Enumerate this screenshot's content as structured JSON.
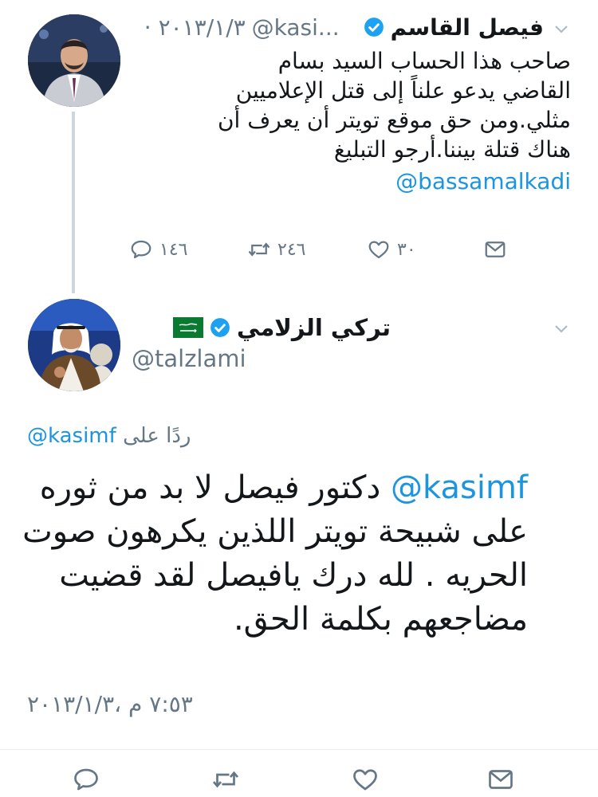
{
  "parent_tweet": {
    "author_name": "فيصل القاسم",
    "handle": "@kasi...",
    "date": "٢٠١٣/١/٣ ·",
    "body_lines": [
      "صاحب هذا الحساب السيد بسام",
      "القاضي يدعو علناً إلى قتل الإعلاميين",
      "مثلي.ومن حق موقع تويتر أن يعرف أن",
      "هناك قتلة بيننا.أرجو التبليغ"
    ],
    "mention": "@bassamalkadi",
    "reply_count": "١٤٦",
    "retweet_count": "٢٤٦",
    "like_count": "٣٠",
    "avatar_icon": "profile-photo-man-suit",
    "verified_icon": "verified-badge-icon"
  },
  "main_tweet": {
    "author_name": "تركي الزلامي",
    "flag_icon": "saudi-flag-icon",
    "handle": "@talzlami",
    "replying_prefix": "ردًا على",
    "replying_to": "@kasimf",
    "mention": "@kasimf",
    "body_lines": [
      " دكتور فيصل لا بد من ثوره",
      "على شبيحة تويتر اللذين يكرهون صوت",
      "الحريه . لله درك يافيصل لقد قضيت",
      "مضاجعهم بكلمة الحق."
    ],
    "timestamp": "٧:٥٣ م ،٢٠١٣/١/٣",
    "avatar_icon": "profile-photo-king"
  },
  "colors": {
    "link": "#1b95e0",
    "muted": "#657786",
    "text": "#14171a",
    "verified": "#1da1f2",
    "thread_line": "#ccd6dd"
  }
}
